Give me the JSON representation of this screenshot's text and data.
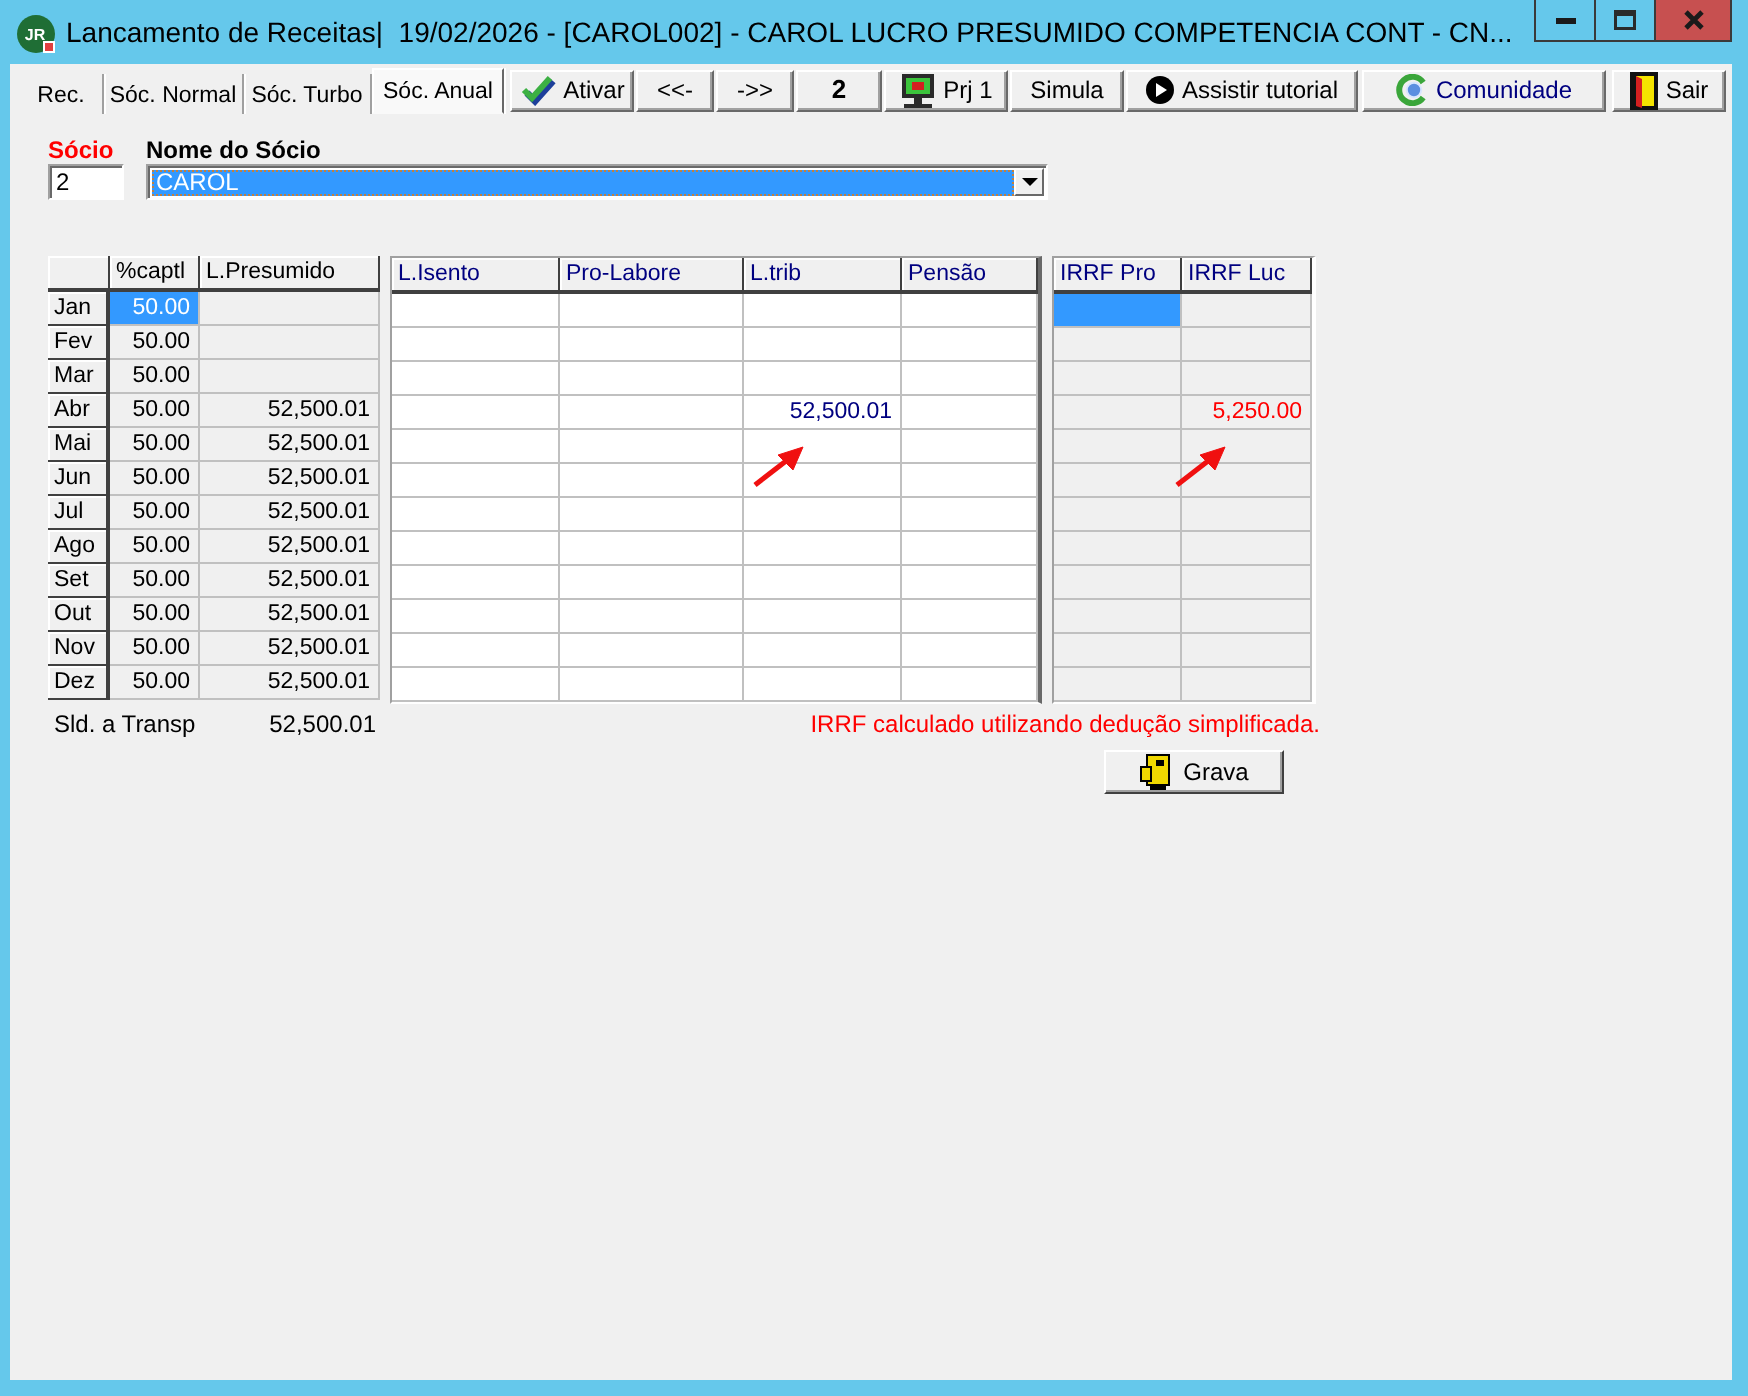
{
  "window": {
    "logo_text": "JR",
    "title": "Lancamento de Receitas|  19/02/2026 - [CAROL002] - CAROL LUCRO PRESUMIDO COMPETENCIA CONT - CN..."
  },
  "tabs": [
    {
      "label": "Rec.",
      "selected": false
    },
    {
      "label": "Sóc. Normal",
      "selected": false
    },
    {
      "label": "Sóc. Turbo",
      "selected": false
    },
    {
      "label": "Sóc. Anual",
      "selected": true
    }
  ],
  "toolbar": [
    {
      "kind": "button",
      "label": "Ativar"
    },
    {
      "kind": "button",
      "label": "<<-"
    },
    {
      "kind": "button",
      "label": "->>"
    },
    {
      "kind": "counter",
      "label": "2"
    },
    {
      "kind": "button",
      "label": "Prj 1"
    },
    {
      "kind": "button",
      "label": "Simula"
    },
    {
      "kind": "button",
      "label": "Assistir tutorial"
    },
    {
      "kind": "link",
      "label": "Comunidade"
    },
    {
      "kind": "button",
      "label": "Sair"
    }
  ],
  "partner": {
    "number_label": "Sócio",
    "number": "2",
    "name_label": "Nome do Sócio",
    "name": "CAROL",
    "name_selected": true
  },
  "grids": [
    {
      "kind": "base",
      "columns": [
        "%captl",
        "L.Presumido"
      ],
      "rows": [
        {
          "month": "Jan",
          "cells": [
            {
              "text": "50.00",
              "selected": true,
              "arrow": false
            },
            {
              "selected": false,
              "arrow": false
            }
          ]
        },
        {
          "month": "Fev",
          "cells": [
            {
              "text": "50.00",
              "selected": false,
              "arrow": false
            },
            {
              "selected": false,
              "arrow": false
            }
          ]
        },
        {
          "month": "Mar",
          "cells": [
            {
              "text": "50.00",
              "selected": false,
              "arrow": false
            },
            {
              "selected": false,
              "arrow": false
            }
          ]
        },
        {
          "month": "Abr",
          "cells": [
            {
              "text": "50.00",
              "selected": false,
              "arrow": false
            },
            {
              "text": "52,500.01",
              "selected": false,
              "arrow": false
            }
          ]
        },
        {
          "month": "Mai",
          "cells": [
            {
              "text": "50.00",
              "selected": false,
              "arrow": false
            },
            {
              "text": "52,500.01",
              "selected": false,
              "arrow": false
            }
          ]
        },
        {
          "month": "Jun",
          "cells": [
            {
              "text": "50.00",
              "selected": false,
              "arrow": false
            },
            {
              "text": "52,500.01",
              "selected": false,
              "arrow": false
            }
          ]
        },
        {
          "month": "Jul",
          "cells": [
            {
              "text": "50.00",
              "selected": false,
              "arrow": false
            },
            {
              "text": "52,500.01",
              "selected": false,
              "arrow": false
            }
          ]
        },
        {
          "month": "Ago",
          "cells": [
            {
              "text": "50.00",
              "selected": false,
              "arrow": false
            },
            {
              "text": "52,500.01",
              "selected": false,
              "arrow": false
            }
          ]
        },
        {
          "month": "Set",
          "cells": [
            {
              "text": "50.00",
              "selected": false,
              "arrow": false
            },
            {
              "text": "52,500.01",
              "selected": false,
              "arrow": false
            }
          ]
        },
        {
          "month": "Out",
          "cells": [
            {
              "text": "50.00",
              "selected": false,
              "arrow": false
            },
            {
              "text": "52,500.01",
              "selected": false,
              "arrow": false
            }
          ]
        },
        {
          "month": "Nov",
          "cells": [
            {
              "text": "50.00",
              "selected": false,
              "arrow": false
            },
            {
              "text": "52,500.01",
              "selected": false,
              "arrow": false
            }
          ]
        },
        {
          "month": "Dez",
          "cells": [
            {
              "text": "50.00",
              "selected": false,
              "arrow": false
            },
            {
              "text": "52,500.01",
              "selected": false,
              "arrow": false
            }
          ]
        }
      ]
    },
    {
      "kind": "entry",
      "columns": [
        "L.Isento",
        "Pro-Labore",
        "L.trib",
        "Pensão"
      ],
      "rows": [
        {
          "cells": [
            {
              "selected": false,
              "arrow": false
            },
            {
              "selected": false,
              "arrow": false
            },
            {
              "selected": false,
              "arrow": false
            },
            {
              "selected": false,
              "arrow": false
            }
          ]
        },
        {
          "cells": [
            {
              "selected": false,
              "arrow": false
            },
            {
              "selected": false,
              "arrow": false
            },
            {
              "selected": false,
              "arrow": false
            },
            {
              "selected": false,
              "arrow": false
            }
          ]
        },
        {
          "cells": [
            {
              "selected": false,
              "arrow": false
            },
            {
              "selected": false,
              "arrow": false
            },
            {
              "selected": false,
              "arrow": false
            },
            {
              "selected": false,
              "arrow": false
            }
          ]
        },
        {
          "cells": [
            {
              "selected": false,
              "arrow": false
            },
            {
              "selected": false,
              "arrow": false
            },
            {
              "text": "52,500.01",
              "selected": false,
              "arrow": true
            },
            {
              "selected": false,
              "arrow": false
            }
          ]
        },
        {
          "cells": [
            {
              "selected": false,
              "arrow": false
            },
            {
              "selected": false,
              "arrow": false
            },
            {
              "selected": false,
              "arrow": false
            },
            {
              "selected": false,
              "arrow": false
            }
          ]
        },
        {
          "cells": [
            {
              "selected": false,
              "arrow": false
            },
            {
              "selected": false,
              "arrow": false
            },
            {
              "selected": false,
              "arrow": false
            },
            {
              "selected": false,
              "arrow": false
            }
          ]
        },
        {
          "cells": [
            {
              "selected": false,
              "arrow": false
            },
            {
              "selected": false,
              "arrow": false
            },
            {
              "selected": false,
              "arrow": false
            },
            {
              "selected": false,
              "arrow": false
            }
          ]
        },
        {
          "cells": [
            {
              "selected": false,
              "arrow": false
            },
            {
              "selected": false,
              "arrow": false
            },
            {
              "selected": false,
              "arrow": false
            },
            {
              "selected": false,
              "arrow": false
            }
          ]
        },
        {
          "cells": [
            {
              "selected": false,
              "arrow": false
            },
            {
              "selected": false,
              "arrow": false
            },
            {
              "selected": false,
              "arrow": false
            },
            {
              "selected": false,
              "arrow": false
            }
          ]
        },
        {
          "cells": [
            {
              "selected": false,
              "arrow": false
            },
            {
              "selected": false,
              "arrow": false
            },
            {
              "selected": false,
              "arrow": false
            },
            {
              "selected": false,
              "arrow": false
            }
          ]
        },
        {
          "cells": [
            {
              "selected": false,
              "arrow": false
            },
            {
              "selected": false,
              "arrow": false
            },
            {
              "selected": false,
              "arrow": false
            },
            {
              "selected": false,
              "arrow": false
            }
          ]
        },
        {
          "cells": [
            {
              "selected": false,
              "arrow": false
            },
            {
              "selected": false,
              "arrow": false
            },
            {
              "selected": false,
              "arrow": false
            },
            {
              "selected": false,
              "arrow": false
            }
          ]
        }
      ]
    },
    {
      "kind": "tax",
      "columns": [
        "IRRF Pro",
        "IRRF Luc"
      ],
      "rows": [
        {
          "cells": [
            {
              "selected": true,
              "arrow": false
            },
            {
              "selected": false,
              "arrow": false
            }
          ]
        },
        {
          "cells": [
            {
              "selected": false,
              "arrow": false
            },
            {
              "selected": false,
              "arrow": false
            }
          ]
        },
        {
          "cells": [
            {
              "selected": false,
              "arrow": false
            },
            {
              "selected": false,
              "arrow": false
            }
          ]
        },
        {
          "cells": [
            {
              "selected": false,
              "arrow": false
            },
            {
              "text": "5,250.00",
              "selected": false,
              "arrow": true
            }
          ]
        },
        {
          "cells": [
            {
              "selected": false,
              "arrow": false
            },
            {
              "selected": false,
              "arrow": false
            }
          ]
        },
        {
          "cells": [
            {
              "selected": false,
              "arrow": false
            },
            {
              "selected": false,
              "arrow": false
            }
          ]
        },
        {
          "cells": [
            {
              "selected": false,
              "arrow": false
            },
            {
              "selected": false,
              "arrow": false
            }
          ]
        },
        {
          "cells": [
            {
              "selected": false,
              "arrow": false
            },
            {
              "selected": false,
              "arrow": false
            }
          ]
        },
        {
          "cells": [
            {
              "selected": false,
              "arrow": false
            },
            {
              "selected": false,
              "arrow": false
            }
          ]
        },
        {
          "cells": [
            {
              "selected": false,
              "arrow": false
            },
            {
              "selected": false,
              "arrow": false
            }
          ]
        },
        {
          "cells": [
            {
              "selected": false,
              "arrow": false
            },
            {
              "selected": false,
              "arrow": false
            }
          ]
        },
        {
          "cells": [
            {
              "selected": false,
              "arrow": false
            },
            {
              "selected": false,
              "arrow": false
            }
          ]
        }
      ]
    }
  ],
  "summary": {
    "label": "Sld. a Transp",
    "value": "52,500.01"
  },
  "notice": "IRRF calculado utilizando dedução simplificada.",
  "save_button": {
    "label": "Grava"
  }
}
